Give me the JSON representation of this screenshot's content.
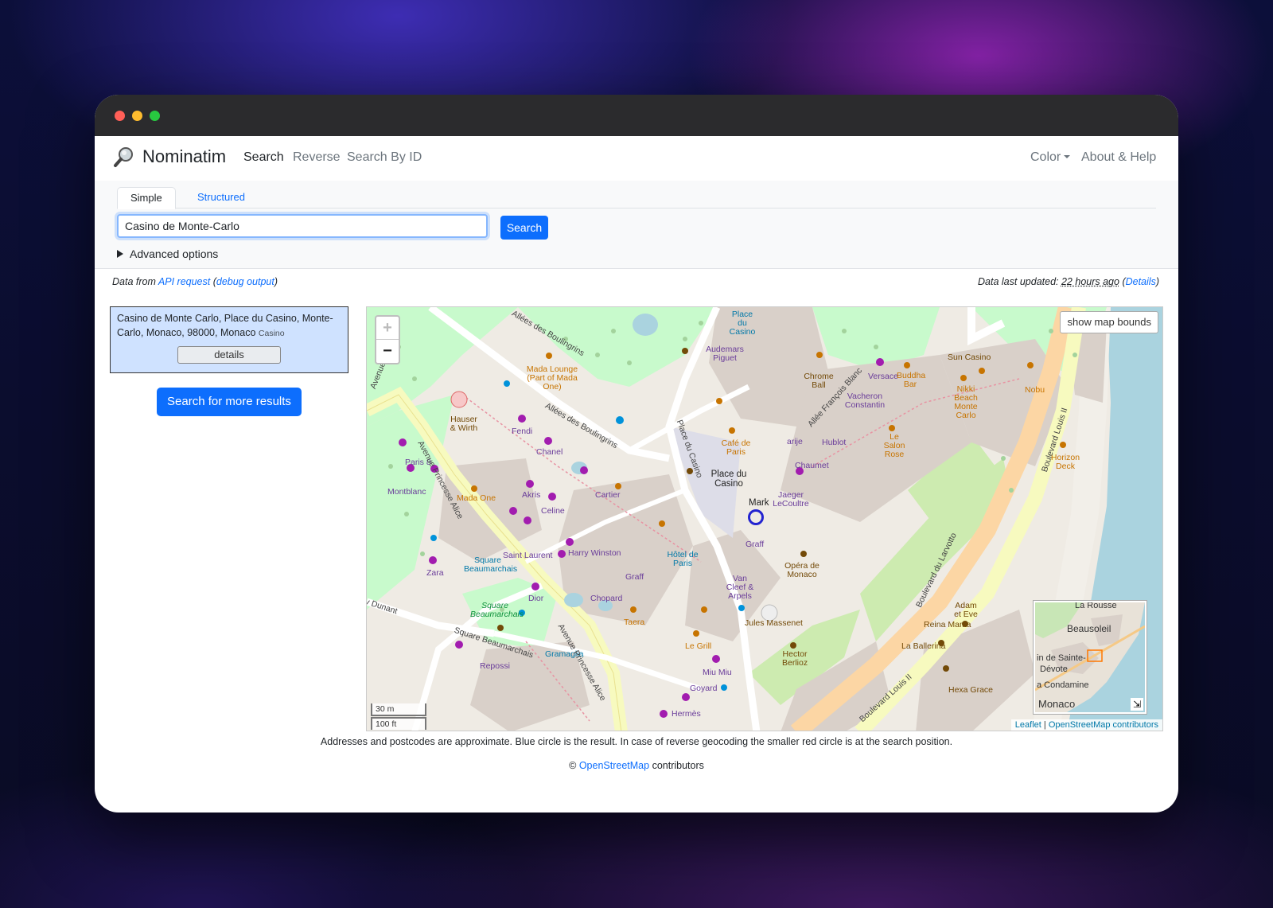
{
  "app": {
    "brand": "Nominatim",
    "nav": [
      "Search",
      "Reverse",
      "Search By ID"
    ],
    "nav_right": [
      "Color",
      "About & Help"
    ]
  },
  "search": {
    "tabs": [
      "Simple",
      "Structured"
    ],
    "query": "Casino de Monte-Carlo",
    "button": "Search",
    "advanced": "Advanced options"
  },
  "info": {
    "data_from": "Data from",
    "api_request": "API request",
    "debug_output": "debug output",
    "updated_label": "Data last updated:",
    "updated_value": "22 hours ago",
    "details_link": "Details"
  },
  "result": {
    "address": "Casino de Monte Carlo, Place du Casino, Monte-Carlo, Monaco, 98000, Monaco",
    "type": "Casino",
    "details_button": "details",
    "more_button": "Search for more results"
  },
  "map": {
    "zoom_in": "+",
    "zoom_out": "−",
    "show_bounds": "show map bounds",
    "scale_m": "30 m",
    "scale_ft": "100 ft",
    "attribution_leaflet": "Leaflet",
    "attribution_osm": "OpenStreetMap contributors",
    "minimap_labels": [
      "La Rousse",
      "Beausoleil",
      "in de Sainte-",
      "Dévote",
      "a Condamine",
      "Monaco"
    ],
    "labels": {
      "place_du_casino_top": "Place du Casino",
      "audemars": "Audemars Piguet",
      "chrome_ball": "Chrome Ball",
      "versace": "Versace",
      "buddha_bar": "Buddha Bar",
      "sun_casino": "Sun Casino",
      "nikki_beach": "Nikki Beach Monte Carlo",
      "nobu": "Nobu",
      "vacheron": "Vacheron Constantin",
      "allee_blanc": "Allée François Blanc",
      "hublot": "Hublot",
      "le_salon_rose": "Le Salon Rose",
      "horizon_deck": "Horizon Deck",
      "boulevard_louis_ii_top": "Boulevard Louis II",
      "boulevard_larvotto": "Boulevard du Larvotto",
      "mada_lounge": "Mada Lounge (Part of Mada One)",
      "allees_boulingrins_top": "Allées des Boulingrins",
      "allees_boulingrins": "Allées des Boulingrins",
      "hauser": "Hauser & Wirth",
      "fendi": "Fendi",
      "chanel": "Chanel",
      "cafe_paris": "Café de Paris",
      "arije": "arije",
      "chaumet": "Chaumet",
      "place_du_casino": "Place du Casino",
      "jaeger": "Jaeger LeCoultre",
      "mark": "Mark",
      "paris8": "Paris 8",
      "avenue_princesse_alice": "Avenue Princesse Alice",
      "montblanc": "Montblanc",
      "mada_one": "Mada One",
      "akris": "Akris",
      "cartier": "Cartier",
      "celine": "Celine",
      "graff": "Graff",
      "graff2": "Graff",
      "saint_laurent": "Saint Laurent",
      "harry_winston": "Harry Winston",
      "hotel_de_paris": "Hôtel de Paris",
      "opera": "Opéra de Monaco",
      "van_cleef": "Van Cleef & Arpels",
      "square_beaumarchais": "Square Beaumarchais",
      "zara": "Zara",
      "dior": "Dior",
      "chopard": "Chopard",
      "taera": "Taera",
      "le_grill": "Le Grill",
      "jules_massenet": "Jules Massenet",
      "hector_berlioz": "Hector Berlioz",
      "adam_eve": "Adam et Eve",
      "reina_mama": "Reina Mama",
      "la_ballerina": "La Ballerina",
      "hexa_grace": "Hexa Grace",
      "y_dunant": "y Dunant",
      "square_beaumarchais_road": "Square Beaumarchais",
      "square_beaumarchais_park": "Square Beaumarchais",
      "gramaglia": "Gramaglia",
      "repossi": "Repossi",
      "miu_miu": "Miu Miu",
      "goyard": "Goyard",
      "hermes": "Hermès",
      "boulevard_louis_ii_bottom": "Boulevard Louis II",
      "avenue_princesse_alice_bottom": "Avenue Princesse Alice",
      "place_du_casino_road": "Place du Casino",
      "avenue_left": "Avenue"
    }
  },
  "footer": {
    "disclaimer": "Addresses and postcodes are approximate. Blue circle is the result. In case of reverse geocoding the smaller red circle is at the search position.",
    "copy_symbol": "©",
    "copy_link": "OpenStreetMap",
    "copy_rest": "contributors"
  },
  "colors": {
    "primary": "#0d6efd",
    "result_bg": "#cfe2ff",
    "park": "#c8facc",
    "road_major": "#fcd6a4",
    "water": "#aad3df"
  }
}
